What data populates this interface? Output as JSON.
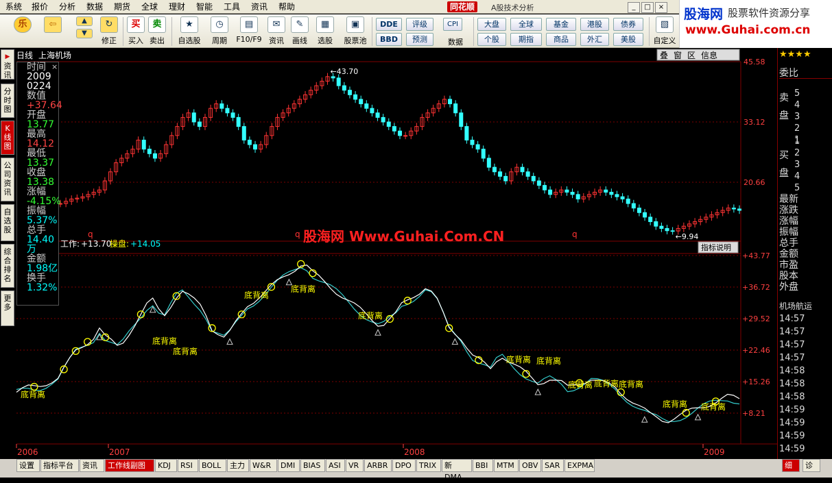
{
  "menu": [
    "系统",
    "报价",
    "分析",
    "数据",
    "期货",
    "全球",
    "理财",
    "智能",
    "工具",
    "资讯",
    "帮助"
  ],
  "app": {
    "logo": "同花顺",
    "title": "A股技术分析"
  },
  "win_buttons": [
    "_",
    "□",
    "×"
  ],
  "toolbar": {
    "buttons": [
      {
        "id": "home",
        "label": "",
        "icon": "乐"
      },
      {
        "id": "back",
        "label": "",
        "icon": "⇦"
      },
      {
        "id": "fix",
        "label": "修正",
        "icon": "↻"
      },
      {
        "id": "buy",
        "label": "买入",
        "icon": "买"
      },
      {
        "id": "sell",
        "label": "卖出",
        "icon": "卖"
      },
      {
        "id": "watch",
        "label": "自选股",
        "icon": "★"
      },
      {
        "id": "period",
        "label": "周期",
        "icon": "◷"
      },
      {
        "id": "f10",
        "label": "F10/F9",
        "icon": "▤"
      },
      {
        "id": "news",
        "label": "资讯",
        "icon": "✉"
      },
      {
        "id": "draw",
        "label": "画线",
        "icon": "✎"
      },
      {
        "id": "pick",
        "label": "选股",
        "icon": "▦"
      },
      {
        "id": "pool",
        "label": "股票池",
        "icon": "▣"
      },
      {
        "id": "data",
        "label": "数据",
        "icon": "▥"
      },
      {
        "id": "custom",
        "label": "自定义",
        "icon": "▧"
      }
    ],
    "small_buttons": [
      "DDE",
      "BBD",
      "评级",
      "预测",
      "CPI",
      "大盘",
      "个股",
      "全球",
      "期指",
      "基金",
      "商品",
      "港股",
      "外汇",
      "债券",
      "美股"
    ]
  },
  "brand": {
    "line1": "股海网",
    "line2": "股票软件资源分享",
    "line3": "www.Guhai.com.cn"
  },
  "lefttabs": [
    "资讯",
    "分时图",
    "K线图",
    "公司资讯",
    "自选股",
    "综合排名",
    "更多"
  ],
  "chart_header": {
    "period": "日线",
    "stock": "上海机场"
  },
  "chart_tools": [
    "叠",
    "窗",
    "区",
    "信息"
  ],
  "info": {
    "time_label": "时间",
    "time_year": "2009",
    "time_md": "0224",
    "value_label": "数值",
    "value": "+37.64",
    "open_label": "开盘",
    "open": "13.77",
    "high_label": "最高",
    "high": "14.12",
    "low_label": "最低",
    "low": "13.37",
    "close_label": "收盘",
    "close": "13.38",
    "change_label": "涨幅",
    "change": "-4.15%",
    "amp_label": "振幅",
    "amp": "5.37%",
    "vol_label": "总手",
    "vol": "14.40万",
    "amt_label": "金额",
    "amt": "1.98亿",
    "turn_label": "换手",
    "turn": "1.32%"
  },
  "indicator": {
    "line1_label": "工作:",
    "line1_value": "+13.70",
    "line2_label": "操盘:",
    "line2_value": "+14.05",
    "help": "指标说明"
  },
  "watermark": "股海网 Www.Guhai.Com.CN",
  "annotations": {
    "divergence": "底背离",
    "q": "q"
  },
  "colors": {
    "up": "#ff3333",
    "down": "#33ffff",
    "grid": "#800000",
    "yellow": "#ffff00",
    "white": "#ffffff",
    "axis": "#ff4040"
  },
  "chart_data": {
    "type": "candlestick_with_indicator",
    "price_axis": {
      "ticks": [
        "45.58",
        "33.12",
        "20.66"
      ]
    },
    "price_labels": {
      "high": "43.70",
      "low": "9.94"
    },
    "price_series": [
      16,
      16.5,
      17,
      17.2,
      17.5,
      18,
      18.5,
      19,
      21,
      23,
      25,
      26,
      27,
      28,
      30,
      28,
      27,
      26,
      27,
      29,
      31,
      33,
      35,
      36,
      34,
      33,
      35,
      37,
      38,
      37,
      36,
      35,
      33,
      30,
      29,
      28,
      29,
      31,
      33,
      35,
      36,
      37,
      38,
      39,
      40,
      41,
      42,
      43,
      44,
      43.7,
      42,
      41,
      40,
      39,
      38,
      37,
      36,
      35,
      34,
      33,
      32,
      31,
      31,
      32,
      33,
      35,
      36,
      37,
      38,
      39,
      38,
      36,
      33,
      30,
      29,
      28,
      26,
      24,
      23,
      22,
      21,
      23,
      24,
      23,
      22,
      21,
      20,
      19,
      18,
      18.5,
      19,
      18.5,
      18,
      17,
      17.5,
      18,
      18.5,
      19,
      18.5,
      18,
      17.5,
      17,
      16,
      15,
      14,
      13,
      12,
      11,
      10.5,
      10,
      9.94,
      10.5,
      11,
      11.5,
      12,
      12.5,
      13,
      13.5,
      14,
      14.5,
      15,
      14.8,
      14.5
    ],
    "indicator_axis": {
      "ticks": [
        "+43.77",
        "+36.72",
        "+29.52",
        "+22.46",
        "+15.26",
        "+8.21"
      ]
    },
    "x_axis_labels": [
      "2006",
      "2007",
      "2008",
      "2009"
    ]
  },
  "right_panel": {
    "ratio_label": "委比",
    "ask_label": "卖盘",
    "bid_label": "买盘",
    "asks": [
      "5",
      "4",
      "3",
      "2",
      "1"
    ],
    "bids": [
      "1",
      "2",
      "3",
      "4",
      "5"
    ],
    "fields": [
      "最新",
      "涨跌",
      "涨幅",
      "振幅",
      "总手",
      "金额",
      "市盈",
      "股本",
      "外盘"
    ],
    "sector": "机场航运",
    "times": [
      "14:57",
      "14:57",
      "14:57",
      "14:57",
      "14:58",
      "14:58",
      "14:58",
      "14:59",
      "14:59",
      "14:59",
      "14:59"
    ],
    "bottom_tabs": [
      "细",
      "诊"
    ]
  },
  "bottom_tabs": [
    "设置",
    "指标平台",
    "资讯",
    "工作线副图",
    "KDJ",
    "RSI",
    "BOLL",
    "主力",
    "W&R",
    "DMI",
    "BIAS",
    "ASI",
    "VR",
    "ARBR",
    "DPO",
    "TRIX",
    "新DMA",
    "BBI",
    "MTM",
    "OBV",
    "SAR",
    "EXPMA"
  ]
}
